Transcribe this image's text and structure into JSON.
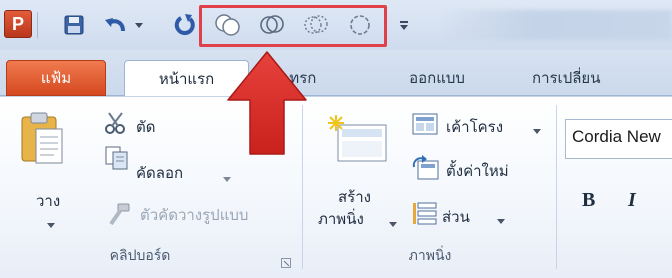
{
  "quick_access_toolbar": {
    "app_icon_letter": "P",
    "buttons": [
      "save-icon",
      "undo-icon",
      "undo-dropdown-icon",
      "redo-icon",
      "shape-combine-icon",
      "shape-intersect-icon",
      "shape-subtract-icon",
      "shape-union-icon",
      "customize-toolbar-icon"
    ],
    "highlight_color": "#e0404a"
  },
  "tabs": {
    "file": "แฟ้ม",
    "home": "หน้าแรก",
    "insert": "แทรก",
    "design": "ออกแบบ",
    "transitions": "การเปลี่ยน"
  },
  "clipboard": {
    "paste": "วาง",
    "cut": "ตัด",
    "copy": "คัดลอก",
    "format_painter": "ตัวคัดวางรูปแบบ",
    "group_label": "คลิปบอร์ด"
  },
  "slides": {
    "new_slide_line1": "สร้าง",
    "new_slide_line2": "ภาพนิ่ง",
    "layout": "เค้าโครง",
    "reset": "ตั้งค่าใหม่",
    "section": "ส่วน",
    "group_label": "ภาพนิ่ง"
  },
  "font": {
    "font_name": "Cordia New",
    "bold": "B",
    "italic": "I"
  },
  "colors": {
    "file_tab": "#d5481f",
    "accent_red": "#e0404a",
    "ribbon_blue": "#cbd9ec"
  }
}
